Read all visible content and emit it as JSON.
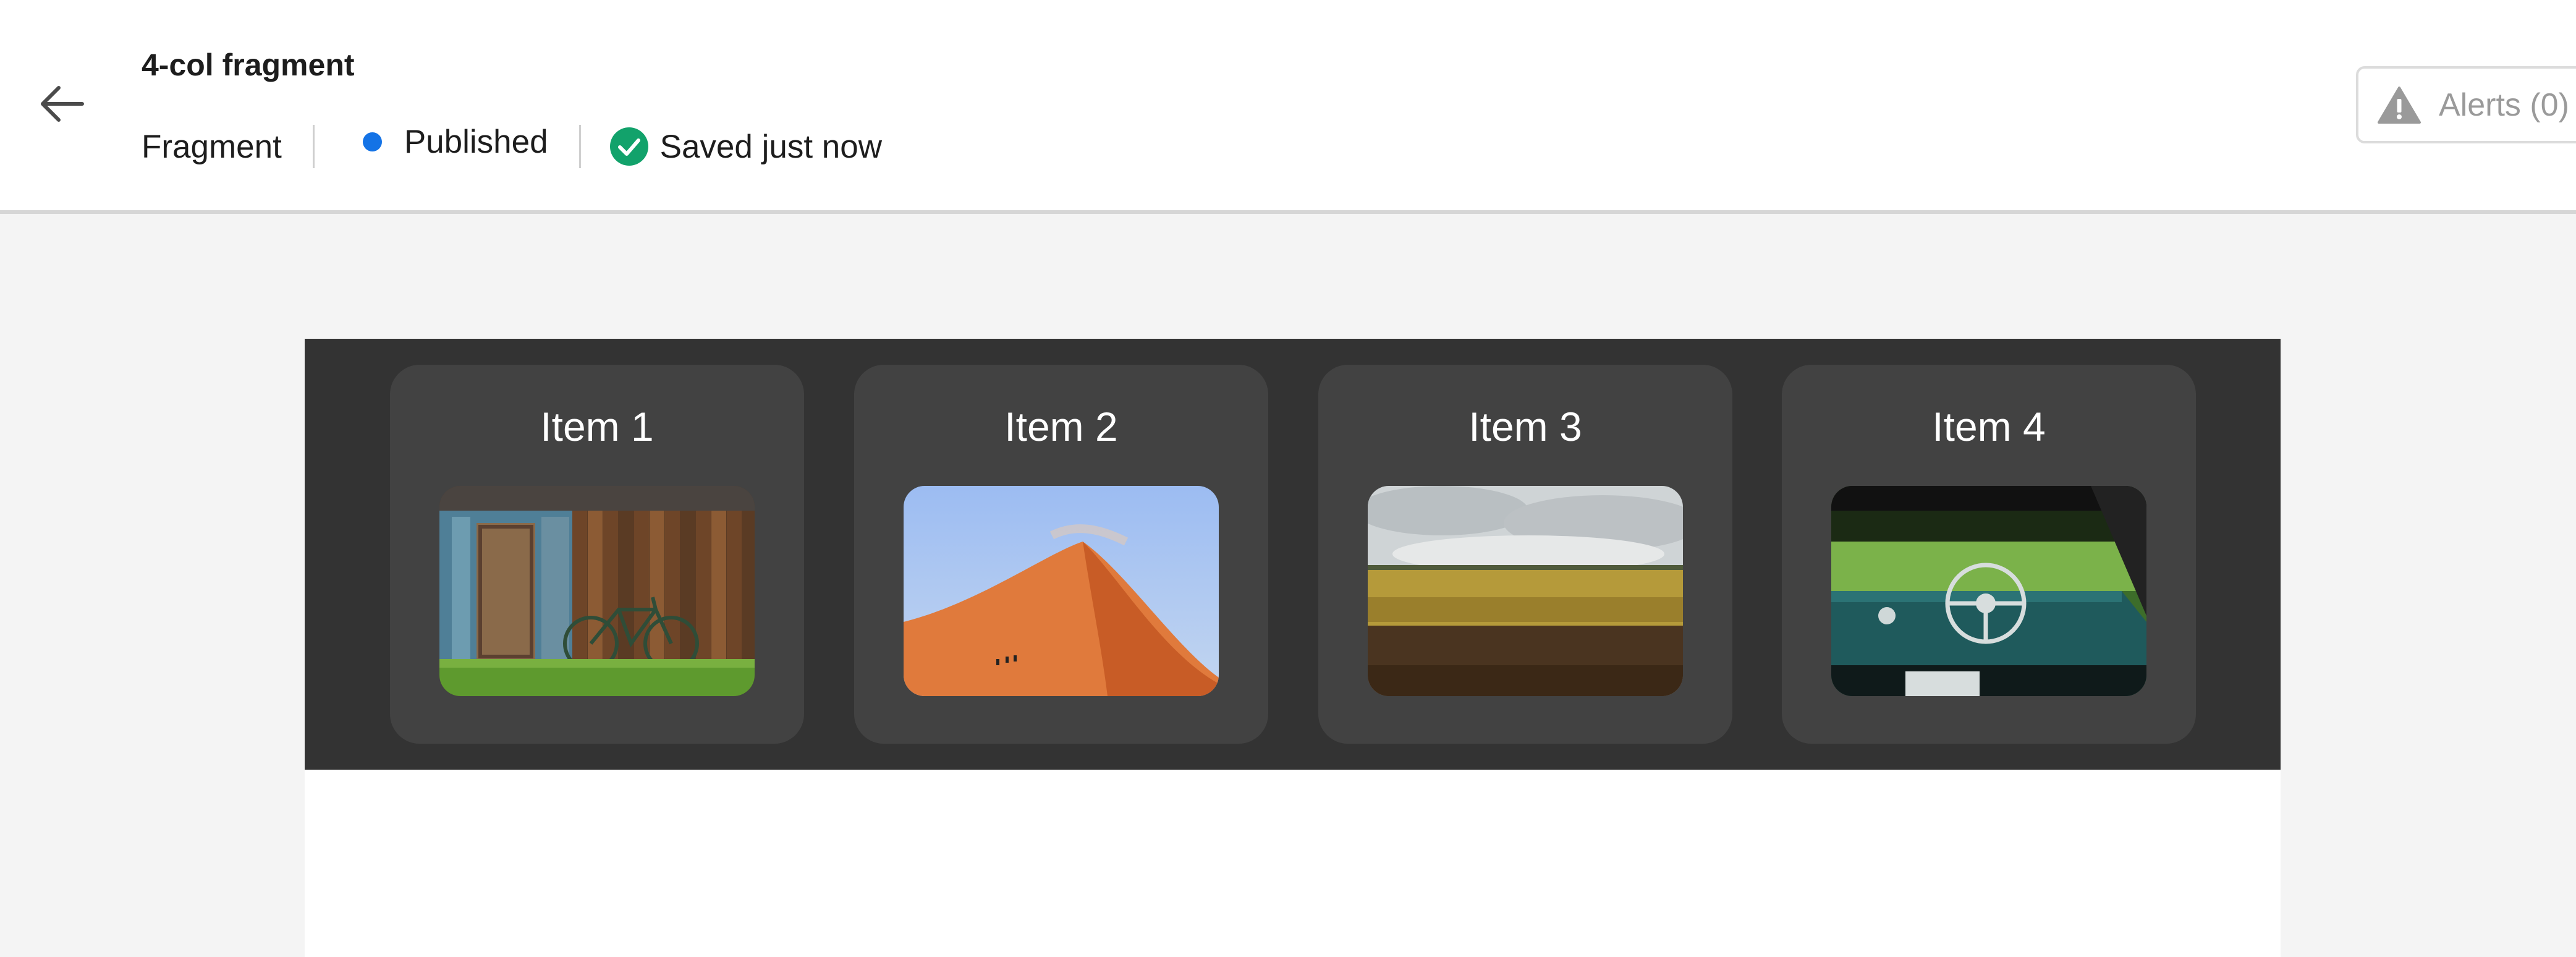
{
  "header": {
    "back_icon": "arrow-left-icon",
    "title": "4-col fragment",
    "type_label": "Fragment",
    "status_label": "Published",
    "status_color": "#1473e6",
    "save_status": "Saved just now",
    "save_icon": "check-circle-icon",
    "save_color": "#12a26b",
    "alerts_label": "Alerts (0)",
    "alerts_icon": "warning-icon"
  },
  "fragment": {
    "background": "#333333",
    "card_background": "#424242",
    "items": [
      {
        "title": "Item 1",
        "image": "wooden-shed-with-bicycle"
      },
      {
        "title": "Item 2",
        "image": "desert-sand-dune"
      },
      {
        "title": "Item 3",
        "image": "wheat-field-under-cloudy-sky"
      },
      {
        "title": "Item 4",
        "image": "vintage-car-interior-steering-wheel"
      }
    ]
  }
}
